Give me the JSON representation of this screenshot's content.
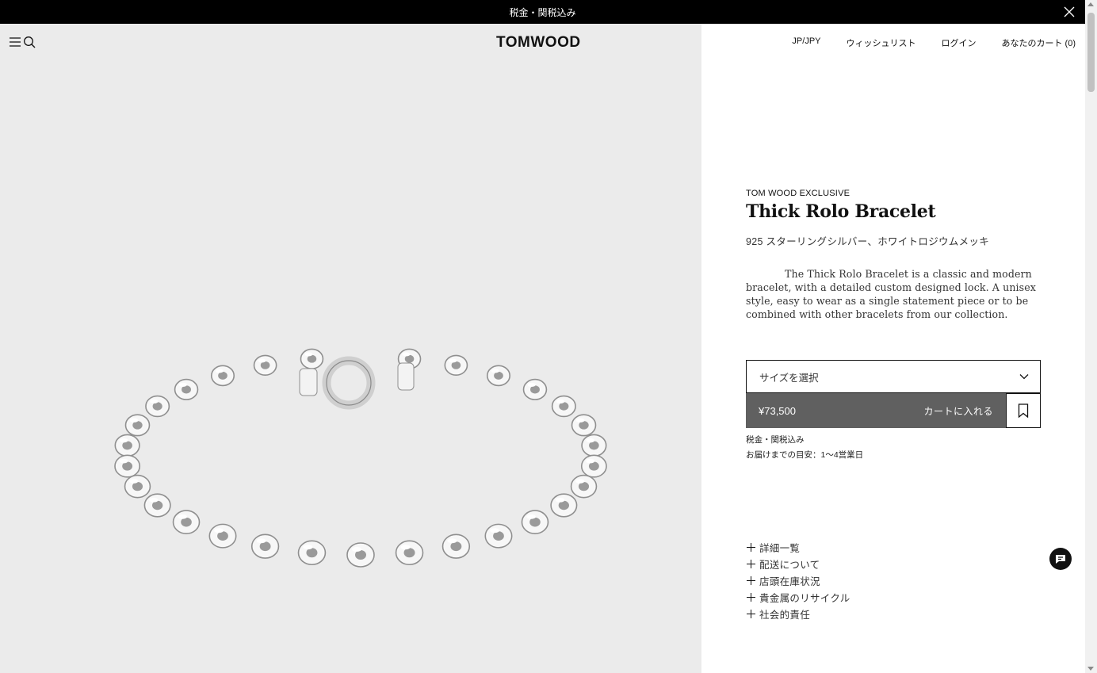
{
  "announcement": {
    "text": "税金・関税込み"
  },
  "header": {
    "logo": "TOMWOOD",
    "nav": {
      "region": "JP/JPY",
      "wishlist": "ウィッシュリスト",
      "login": "ログイン",
      "cart": "あなたのカート (0)"
    }
  },
  "product": {
    "eyebrow": "TOM WOOD EXCLUSIVE",
    "title": "Thick Rolo Bracelet",
    "material": "925 スターリングシルバー、ホワイトロジウムメッキ",
    "description": "The Thick Rolo Bracelet is a classic and modern bracelet, with a detailed custom designed lock. A unisex style, easy to wear as a single statement piece or to be combined with other bracelets from our collection.",
    "size_placeholder": "サイズを選択",
    "price": "¥73,500",
    "add_to_cart": "カートに入れる",
    "tax_note": "税金・関税込み",
    "delivery_note": "お届けまでの目安：1〜4営業日"
  },
  "accordion": [
    {
      "label": "詳細一覧"
    },
    {
      "label": "配送について"
    },
    {
      "label": "店頭在庫状況"
    },
    {
      "label": "貴金属のリサイクル"
    },
    {
      "label": "社会的責任"
    }
  ],
  "icons": {
    "close": "close-icon",
    "menu": "menu-icon",
    "search": "search-icon",
    "chevron": "chevron-down-icon",
    "bookmark": "bookmark-icon",
    "chat": "chat-icon"
  },
  "colors": {
    "announcement_bg": "#000000",
    "gallery_bg": "#ebebeb",
    "add_to_cart_bg": "#606060"
  }
}
